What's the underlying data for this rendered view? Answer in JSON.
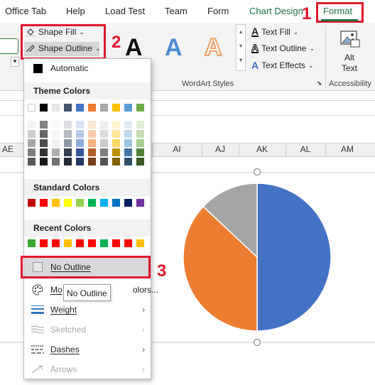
{
  "tabs": [
    "Office Tab",
    "Help",
    "Load Test",
    "Team",
    "Form",
    "Chart Design",
    "Format"
  ],
  "ribbon": {
    "shape_fill": "Shape Fill",
    "shape_outline": "Shape Outline",
    "wordart_letter": "A",
    "text_fill": "Text Fill",
    "text_outline": "Text Outline",
    "text_effects": "Text Effects",
    "wordart_group": "WordArt Styles",
    "alt_text_line1": "Alt",
    "alt_text_line2": "Text",
    "accessibility_group": "Accessibility"
  },
  "columns": [
    "AE",
    "AI",
    "AJ",
    "AK",
    "AL",
    "AM"
  ],
  "dropdown": {
    "automatic": "Automatic",
    "theme_colors": "Theme Colors",
    "standard_colors": "Standard Colors",
    "recent_colors": "Recent Colors",
    "no_outline": "No Outline",
    "more_colors": "More Outline Colors...",
    "more_colors_visible_start": "Mo",
    "more_colors_visible_end": "olors...",
    "weight": "Weight",
    "sketched": "Sketched",
    "dashes": "Dashes",
    "arrows": "Arrows"
  },
  "tooltip": "No Outline",
  "step_numbers": [
    "1",
    "2",
    "3"
  ],
  "colors": {
    "theme_top": [
      "#ffffff",
      "#000000",
      "#e7e6e6",
      "#44546a",
      "#4472c4",
      "#ed7d31",
      "#a5a5a5",
      "#ffc000",
      "#5b9bd5",
      "#70ad47"
    ],
    "standard": [
      "#c00000",
      "#ff0000",
      "#ffc000",
      "#ffff00",
      "#92d050",
      "#00b050",
      "#00b0f0",
      "#0070c0",
      "#002060",
      "#7030a0"
    ],
    "recent": [
      "#38a832",
      "#ff0000",
      "#ff0000",
      "#ffc000",
      "#ff0000",
      "#ff0000",
      "#00b050",
      "#ff0000",
      "#ff0000",
      "#ffc000"
    ],
    "accent_red": "#e0182e",
    "accent_green": "#1e7145"
  },
  "chart_data": {
    "type": "pie",
    "values": [
      50,
      37,
      13
    ],
    "colors": [
      "#4472c4",
      "#ed7d31",
      "#a5a5a5"
    ]
  }
}
